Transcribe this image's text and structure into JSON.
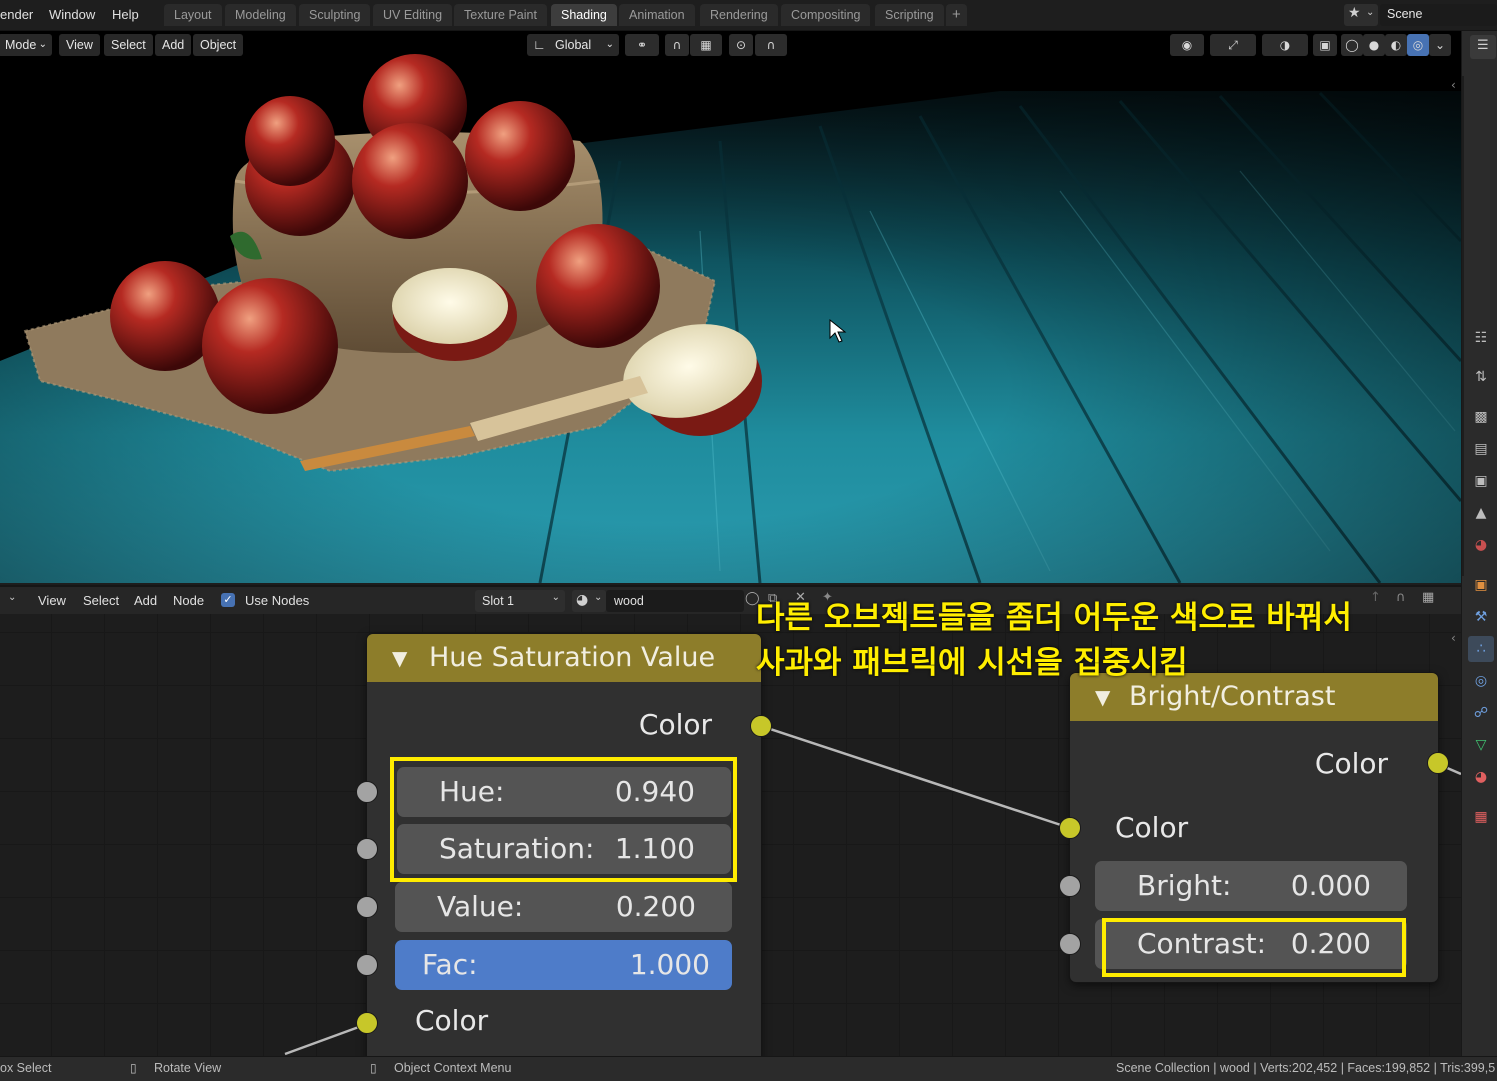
{
  "topbar": {
    "menus": [
      "ender",
      "Window",
      "Help"
    ],
    "workspaces": [
      "Layout",
      "Modeling",
      "Sculpting",
      "UV Editing",
      "Texture Paint",
      "Shading",
      "Animation",
      "Rendering",
      "Compositing",
      "Scripting"
    ],
    "active_workspace": "Shading",
    "add_tab": "+",
    "scene_name": "Scene"
  },
  "viewport_header": {
    "mode": "Mode",
    "menus": [
      "View",
      "Select",
      "Add",
      "Object"
    ],
    "orientation": "Global"
  },
  "node_editor": {
    "header": {
      "menus": [
        "View",
        "Select",
        "Add",
        "Node"
      ],
      "use_nodes_label": "Use Nodes",
      "use_nodes_checked": true,
      "slot": "Slot 1",
      "material": "wood"
    },
    "hsv_node": {
      "title": "Hue Saturation Value",
      "output": "Color",
      "fields": [
        {
          "label": "Hue:",
          "value": "0.940"
        },
        {
          "label": "Saturation:",
          "value": "1.100"
        },
        {
          "label": "Value:",
          "value": "0.200"
        },
        {
          "label": "Fac:",
          "value": "1.000"
        }
      ],
      "input": "Color"
    },
    "bc_node": {
      "title": "Bright/Contrast",
      "output": "Color",
      "input": "Color",
      "fields": [
        {
          "label": "Bright:",
          "value": "0.000"
        },
        {
          "label": "Contrast:",
          "value": "0.200"
        }
      ]
    },
    "annotation_lines": [
      "다른 오브젝트들을 좀더 어두운 색으로 바꿔서",
      "사과와 패브릭에 시선을 집중시킴"
    ],
    "annotation_color": "#ffee00"
  },
  "statusbar": {
    "select": "ox Select",
    "rotate": "Rotate View",
    "context": "Object Context Menu",
    "stats": "Scene Collection | wood | Verts:202,452 | Faces:199,852 | Tris:399,5"
  },
  "colors": {
    "node_header": "#8d7d2a",
    "socket_color": "#c7c729",
    "fac_field": "#4e7cc9",
    "highlight": "#ffec00"
  }
}
